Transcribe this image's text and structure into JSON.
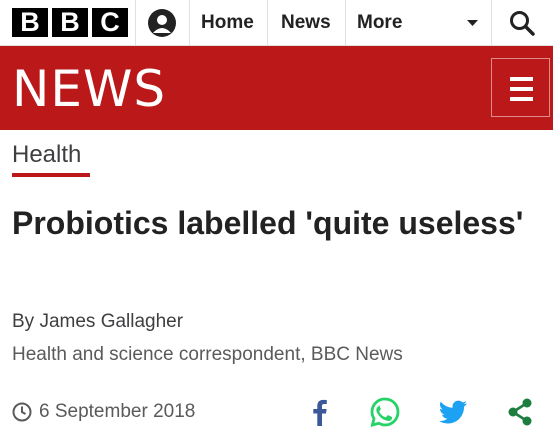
{
  "brand": {
    "letters": [
      "B",
      "B",
      "C"
    ],
    "masthead": "NEWS",
    "colors": {
      "news_red": "#bb1919",
      "black": "#000000",
      "whatsapp": "#25d366",
      "twitter": "#1da1f2",
      "facebook": "#3b5998",
      "share": "#1d7d3f"
    }
  },
  "nav": {
    "account_icon": "account-icon",
    "items": [
      "Home",
      "News",
      "More"
    ],
    "more_icon": "chevron-down-icon",
    "search_icon": "search-icon"
  },
  "menu_icon": "hamburger-menu-icon",
  "article": {
    "section": "Health",
    "headline": "Probiotics labelled 'quite useless'",
    "byline": "By James Gallagher",
    "role": "Health and science correspondent, BBC News",
    "date": "6 September 2018"
  },
  "share_icons": [
    "facebook-icon",
    "whatsapp-icon",
    "twitter-icon",
    "share-icon"
  ]
}
